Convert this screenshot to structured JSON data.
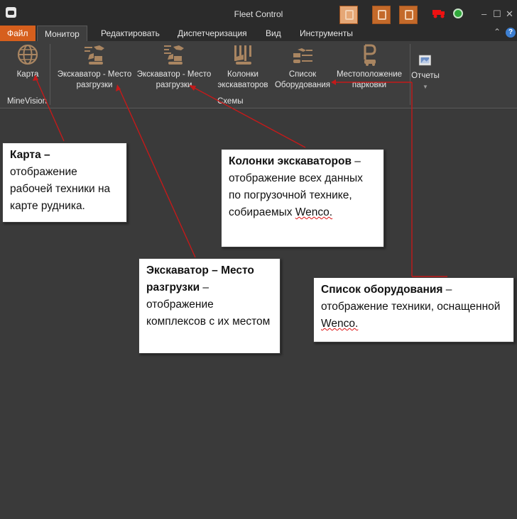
{
  "window": {
    "title": "Fleet Control",
    "icons": [
      "route-icon",
      "clipboard-icon",
      "document-icon",
      "truck-icon",
      "network-status-icon"
    ]
  },
  "menu": {
    "tabs": [
      {
        "label": "Файл"
      },
      {
        "label": "Монитор"
      },
      {
        "label": "Редактировать"
      },
      {
        "label": "Диспетчеризация"
      },
      {
        "label": "Вид"
      },
      {
        "label": "Инструменты"
      }
    ],
    "active_tab": "Монитор"
  },
  "ribbon": {
    "items": [
      {
        "line1": "Карта",
        "line2": "",
        "icon": "globe-icon"
      },
      {
        "line1": "Экскаватор - Место",
        "line2": "разгрузки",
        "icon": "excavator-dump-icon"
      },
      {
        "line1": "Экскаватор - Место",
        "line2": "разгрузки",
        "icon": "excavator-dump-icon"
      },
      {
        "line1": "Колонки",
        "line2": "экскаваторов",
        "icon": "excavator-columns-icon"
      },
      {
        "line1": "Список",
        "line2": "Оборудования",
        "icon": "equipment-list-icon"
      },
      {
        "line1": "Местоположение",
        "line2": "парковки",
        "icon": "parking-icon"
      },
      {
        "line1": "Отчеты",
        "line2": "",
        "icon": "reports-icon"
      }
    ],
    "groups": [
      "MineVision",
      "Схемы"
    ]
  },
  "callouts": {
    "map": {
      "title": "Карта –",
      "text": "отображение рабочей техники на карте рудника."
    },
    "excavator": {
      "title": "Экскаватор – Место разгрузки",
      "text": "отображение комплексов с их местом"
    },
    "columns": {
      "title": "Колонки экскаваторов",
      "text": "отображение всех данных по погрузочной технике, собираемых",
      "brand": "Wenco."
    },
    "equipment": {
      "title": "Список оборудования",
      "text": "отображение техники, оснащенной",
      "brand": "Wenco."
    }
  },
  "colors": {
    "accent": "#d65f1d",
    "background": "#3a3a3a",
    "arrow": "#c41a1a"
  }
}
